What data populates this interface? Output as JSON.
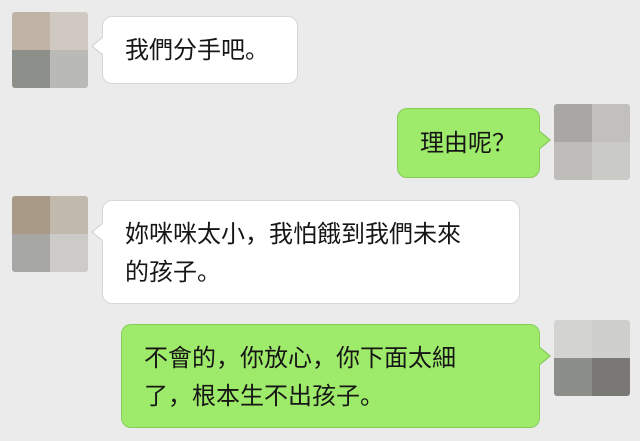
{
  "messages": [
    {
      "side": "incoming",
      "lines": [
        "我們分手吧。"
      ]
    },
    {
      "side": "outgoing",
      "lines": [
        "理由呢？"
      ]
    },
    {
      "side": "incoming",
      "lines": [
        "妳咪咪太小，我怕餓到我們未來",
        "的孩子。"
      ]
    },
    {
      "side": "outgoing",
      "lines": [
        "不會的，你放心，你下面太細",
        "了，根本生不出孩子。"
      ]
    }
  ],
  "colors": {
    "background": "#ebebeb",
    "incoming_bubble": "#ffffff",
    "outgoing_bubble": "#9eea6a"
  }
}
